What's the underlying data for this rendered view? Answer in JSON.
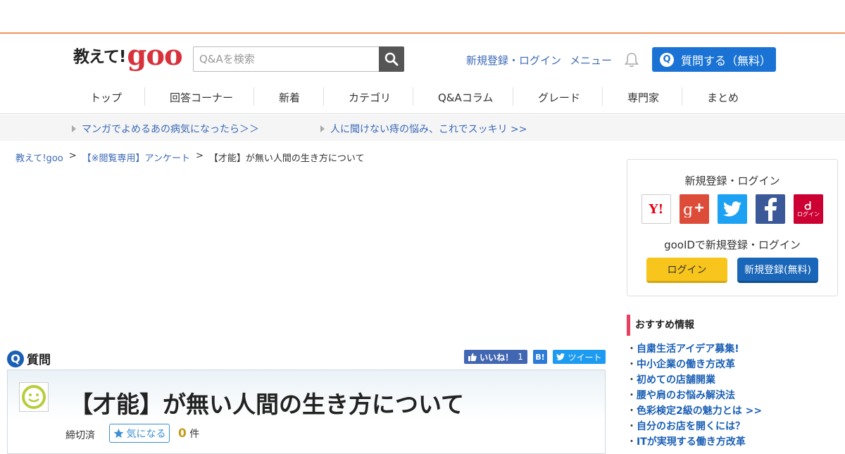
{
  "header": {
    "logo_text": "教えて!",
    "logo_brand": "goo",
    "search_placeholder": "Q&Aを検索",
    "signup_login": "新規登録・ログイン",
    "menu": "メニュー",
    "ask_button": "質問する（無料）",
    "ask_icon": "Q"
  },
  "nav": {
    "items": [
      "トップ",
      "回答コーナー",
      "新着",
      "カテゴリ",
      "Q&Aコラム",
      "グレード",
      "専門家",
      "まとめ"
    ]
  },
  "promo": {
    "links": [
      "マンガでよめるあの病気になったら＞＞",
      "人に聞けない痔の悩み、これでスッキリ >>"
    ]
  },
  "breadcrumb": {
    "items": [
      "教えて!goo",
      "【※閲覧専用】アンケート",
      "【才能】が無い人間の生き方について"
    ],
    "separator": ">"
  },
  "question": {
    "section_icon": "Q",
    "section_label": "質問",
    "like_label": "いいね！",
    "like_count": "1",
    "hatena_label": "B!",
    "tweet_label": "ツイート",
    "title": "【才能】が無い人間の生き方について",
    "status": "締切済",
    "watch_label": "気になる",
    "watch_count": "0",
    "watch_unit": "件"
  },
  "login_box": {
    "title": "新規登録・ログイン",
    "providers": [
      "Yahoo",
      "Google+",
      "Twitter",
      "Facebook",
      "docomo"
    ],
    "yahoo_text": "Y!",
    "docomo_text": "ログイン",
    "subtitle": "gooIDで新規登録・ログイン",
    "login_button": "ログイン",
    "register_button": "新規登録(無料)"
  },
  "recommend": {
    "heading": "おすすめ情報",
    "items": [
      "自粛生活アイデア募集!",
      "中小企業の働き方改革",
      "初めての店舗開業",
      "腰や肩のお悩み解決法",
      "色彩検定2級の魅力とは >>",
      "自分のお店を開くには？",
      "ITが実現する働き方改革"
    ]
  },
  "colors": {
    "accent_orange": "#f0935a",
    "brand_red": "#d7323c",
    "primary_blue": "#1a73d4",
    "link_blue": "#3b69b6",
    "login_yellow": "#f7c51b",
    "register_blue": "#1a66b8",
    "recommend_bar": "#e94060"
  }
}
